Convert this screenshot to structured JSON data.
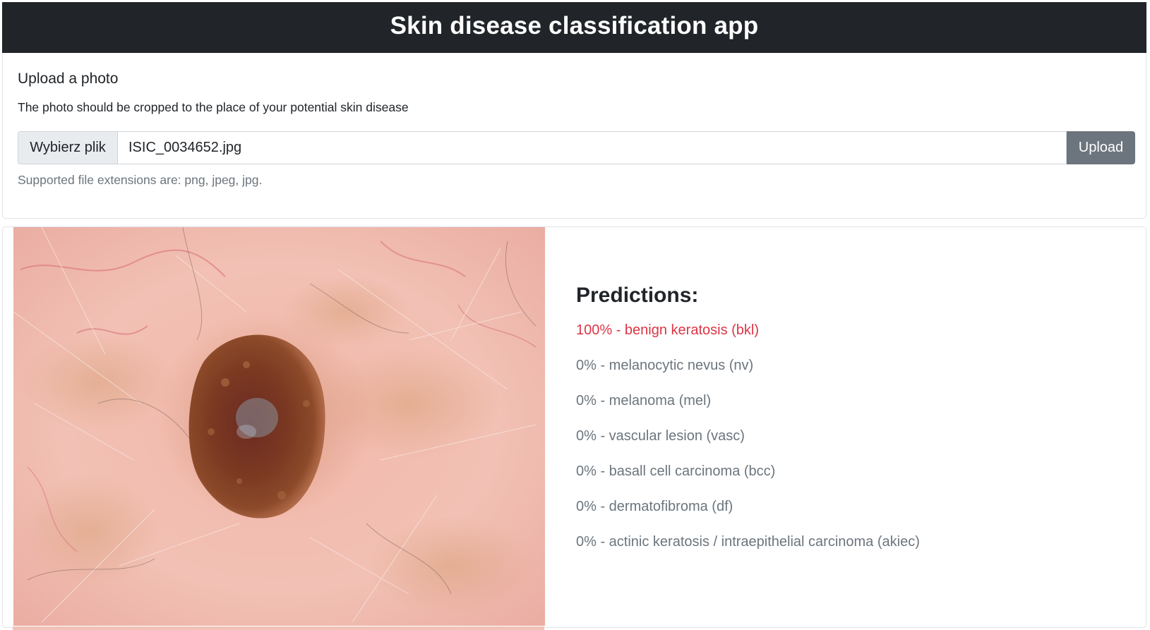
{
  "header": {
    "title": "Skin disease classification app"
  },
  "upload": {
    "title": "Upload a photo",
    "description": "The photo should be cropped to the place of your potential skin disease",
    "choose_file_label": "Wybierz plik",
    "file_name": "ISIC_0034652.jpg",
    "upload_label": "Upload",
    "help_text": "Supported file extensions are: png, jpeg, jpg."
  },
  "results": {
    "heading": "Predictions:",
    "predictions": [
      {
        "text": "100% - benign keratosis (bkl)",
        "value": 100,
        "top": true
      },
      {
        "text": "0% - melanocytic nevus (nv)",
        "value": 0
      },
      {
        "text": "0% - melanoma (mel)",
        "value": 0
      },
      {
        "text": "0% - vascular lesion (vasc)",
        "value": 0
      },
      {
        "text": "0% - basall cell carcinoma (bcc)",
        "value": 0
      },
      {
        "text": "0% - dermatofibroma (df)",
        "value": 0
      },
      {
        "text": "0% - actinic keratosis / intraepithelial carcinoma (akiec)",
        "value": 0
      }
    ]
  },
  "colors": {
    "navbar": "#212529",
    "top_prediction": "#dc3545",
    "muted_text": "#6c757d",
    "upload_button": "#6c757d"
  }
}
